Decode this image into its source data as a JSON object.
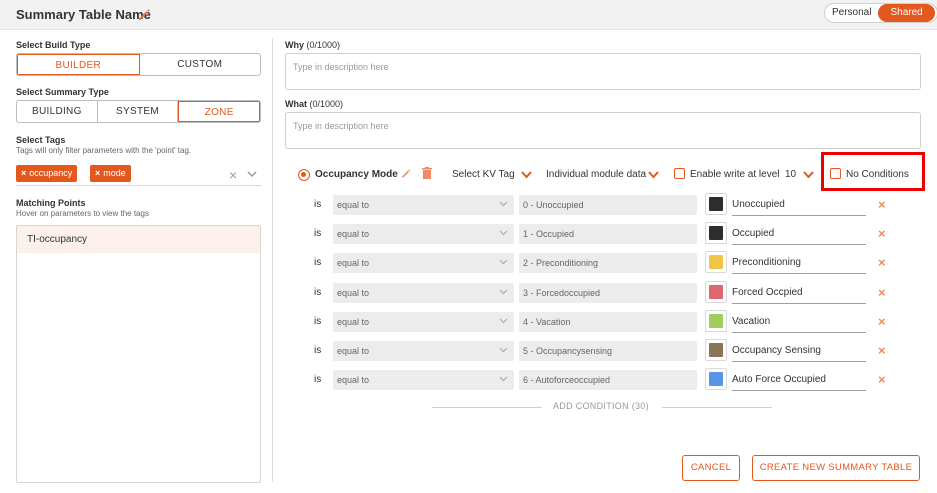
{
  "header": {
    "title": "Summary Table Name",
    "edit_icon": "pencil-icon",
    "share_toggle": {
      "personal": "Personal",
      "shared": "Shared",
      "selected": "Shared"
    }
  },
  "left": {
    "build_type": {
      "label": "Select Build Type",
      "options": [
        "BUILDER",
        "CUSTOM"
      ],
      "selected": "BUILDER"
    },
    "summary_type": {
      "label": "Select Summary Type",
      "options": [
        "BUILDING",
        "SYSTEM",
        "ZONE"
      ],
      "selected": "ZONE"
    },
    "tags": {
      "label": "Select Tags",
      "hint": "Tags will only filter parameters with the 'point' tag.",
      "chips": [
        "occupancy",
        "mode"
      ],
      "chip_remove_glyph": "×",
      "clear_glyph": "×"
    },
    "matching": {
      "label": "Matching Points",
      "hint": "Hover on parameters to view the tags",
      "items": [
        "TI-occupancy"
      ]
    }
  },
  "right": {
    "why": {
      "label": "Why",
      "counter": "(0/1000)",
      "placeholder": "Type in description here"
    },
    "what": {
      "label": "What",
      "counter": "(0/1000)",
      "placeholder": "Type in description here"
    },
    "condition_header": {
      "name": "Occupancy Mode",
      "kv_tag": "Select KV Tag",
      "module_data": "Individual module data",
      "enable_write": "Enable write at level",
      "level": "10",
      "no_conditions": "No Conditions"
    },
    "rows": [
      {
        "is": "is",
        "comparator": "equal to",
        "value": "0 - Unoccupied",
        "color": "#2d2d2d",
        "display": "Unoccupied"
      },
      {
        "is": "is",
        "comparator": "equal to",
        "value": "1 - Occupied",
        "color": "#2d2d2d",
        "display": "Occupied"
      },
      {
        "is": "is",
        "comparator": "equal to",
        "value": "2 - Preconditioning",
        "color": "#f0c54a",
        "display": "Preconditioning"
      },
      {
        "is": "is",
        "comparator": "equal to",
        "value": "3 - Forcedoccupied",
        "color": "#de6872",
        "display": "Forced Occpied"
      },
      {
        "is": "is",
        "comparator": "equal to",
        "value": "4 - Vacation",
        "color": "#a2cc5c",
        "display": "Vacation"
      },
      {
        "is": "is",
        "comparator": "equal to",
        "value": "5 - Occupancysensing",
        "color": "#8a7557",
        "display": "Occupancy Sensing"
      },
      {
        "is": "is",
        "comparator": "equal to",
        "value": "6 - Autoforceoccupied",
        "color": "#5a95e8",
        "display": "Auto Force Occupied"
      }
    ],
    "delete_glyph": "×",
    "add_condition": "ADD CONDITION (30)",
    "cancel": "CANCEL",
    "create": "CREATE NEW SUMMARY TABLE"
  },
  "colors": {
    "accent": "#e2581f",
    "highlight": "#e00000"
  }
}
